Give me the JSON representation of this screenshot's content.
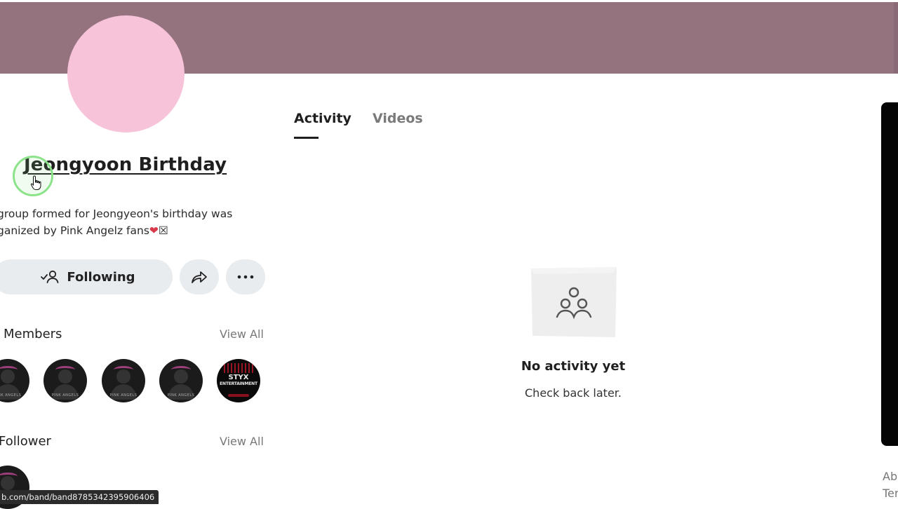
{
  "band": {
    "name": "Jeongyoon Birthday",
    "description_line1": "group formed for Jeongyeon's birthday was",
    "description_line2": "ganized by Pink Angelz fans",
    "description_emoji": "❤",
    "description_box": "☒"
  },
  "actions": {
    "following_label": "Following",
    "share_icon": "share-arrow-icon",
    "more_icon": "more-dots-icon"
  },
  "members": {
    "title": "Members",
    "view_all": "View All",
    "avatar_tag": "PINK ANGELS",
    "styx_line1": "STYX",
    "styx_line2": "ENTERTAINMENT"
  },
  "followers": {
    "title": "Follower",
    "view_all": "View All"
  },
  "tabs": [
    {
      "label": "Activity",
      "active": true
    },
    {
      "label": "Videos",
      "active": false
    }
  ],
  "empty_state": {
    "title": "No activity yet",
    "subtitle": "Check back later."
  },
  "footer": {
    "link1": "Ab",
    "link2": "Ter"
  },
  "status_bar": {
    "url": "b.com/band/band8785342395906406"
  },
  "colors": {
    "cover": "#94737f",
    "avatar": "#f7c3d9",
    "button_bg": "#e8ecee",
    "click_ring": "#8ce38a"
  }
}
